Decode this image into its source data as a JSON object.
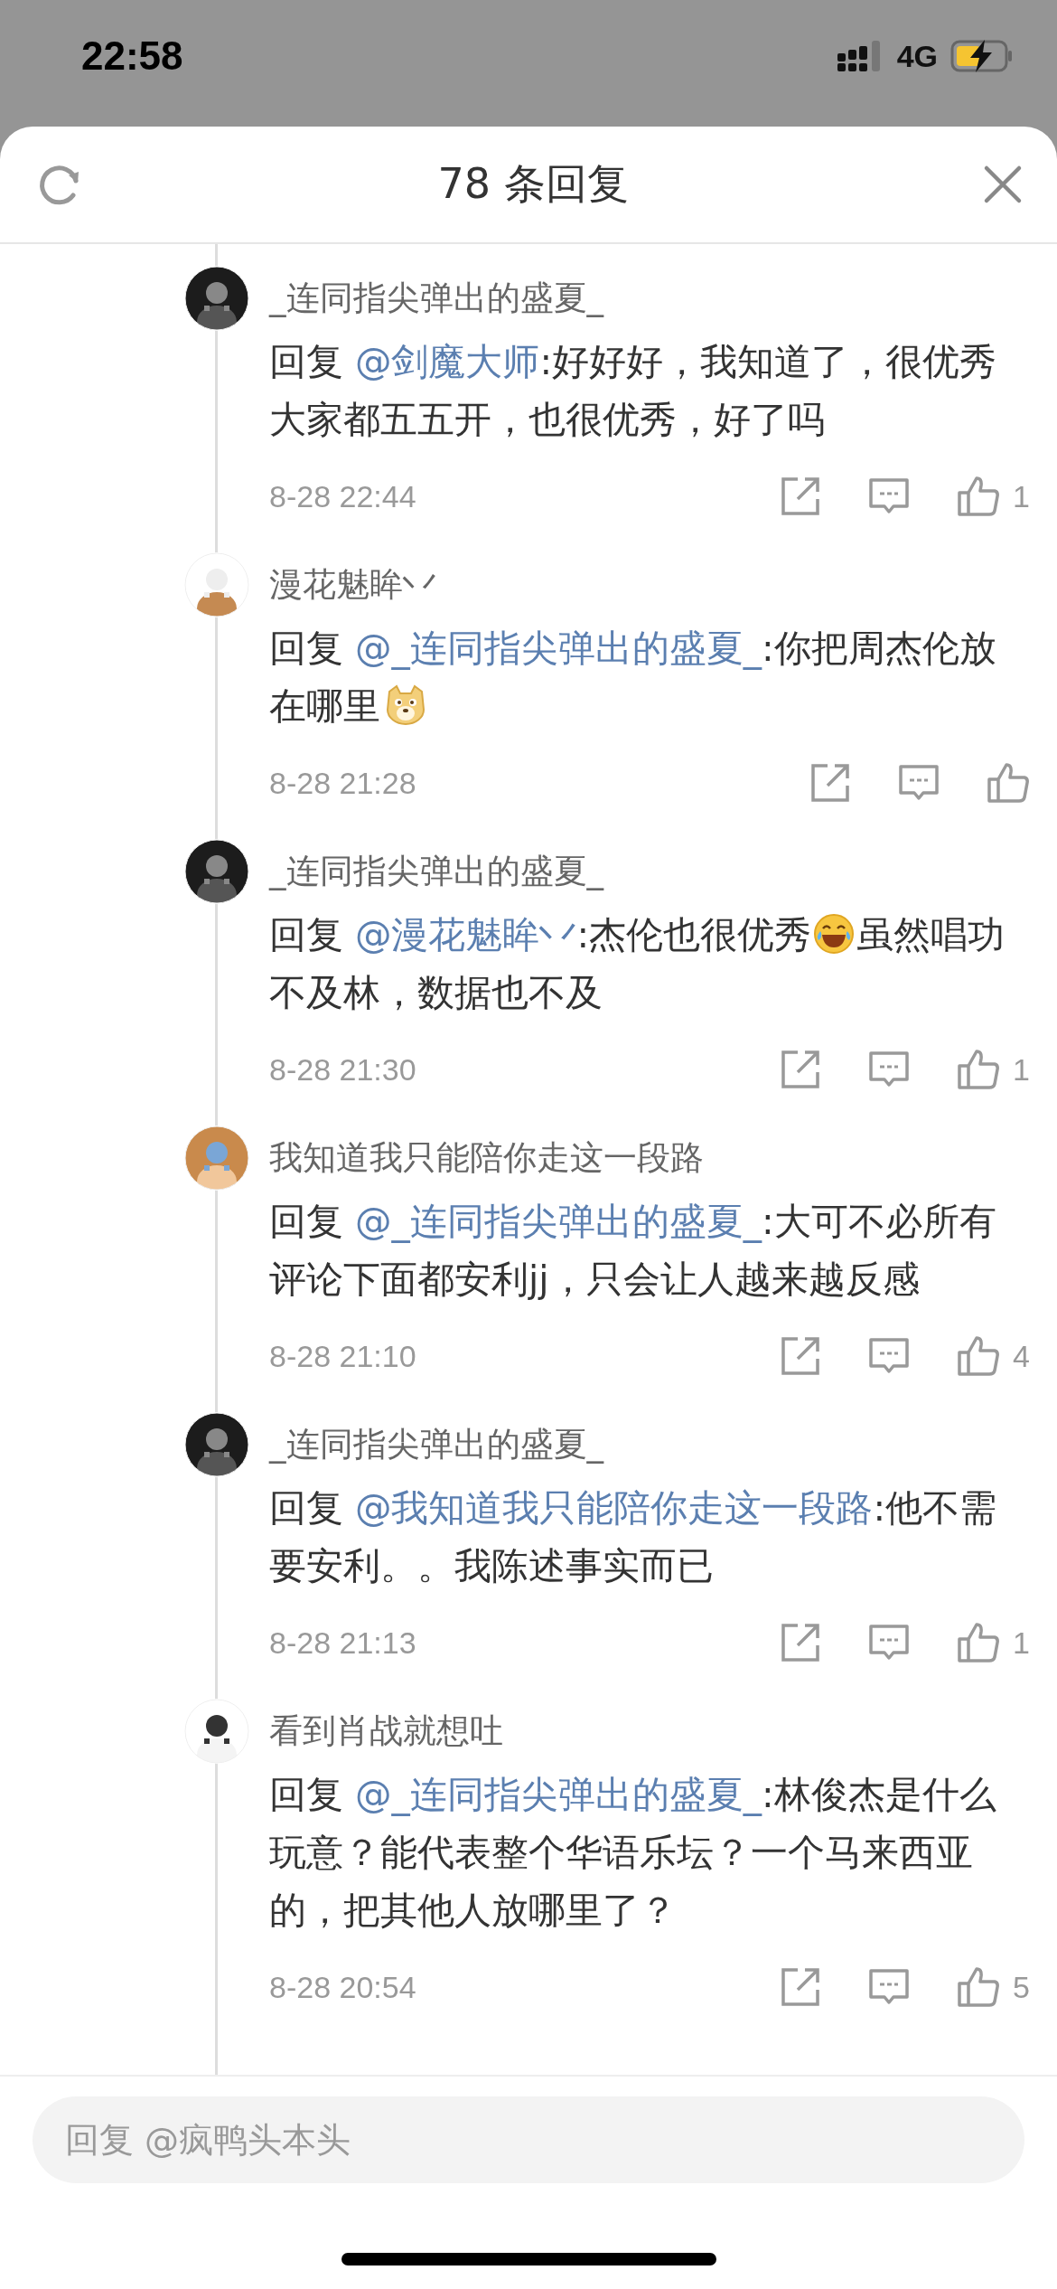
{
  "status_bar": {
    "time": "22:58",
    "network": "4G"
  },
  "header": {
    "title": "78 条回复"
  },
  "comments": [
    {
      "author": "_连同指尖弹出的盛夏_",
      "body": [
        {
          "kind": "text",
          "text": "回复 "
        },
        {
          "kind": "mention",
          "text": "@剑魔大师"
        },
        {
          "kind": "text",
          "text": ":好好好，我知道了，很优秀大家都五五开，也很优秀，好了吗"
        }
      ],
      "time": "8-28 22:44",
      "likes": "1"
    },
    {
      "author": "漫花魅眸丷",
      "body": [
        {
          "kind": "text",
          "text": "回复 "
        },
        {
          "kind": "mention",
          "text": "@_连同指尖弹出的盛夏_"
        },
        {
          "kind": "text",
          "text": ":你把周杰伦放在哪里"
        },
        {
          "kind": "dog-emoji"
        }
      ],
      "time": "8-28 21:28"
    },
    {
      "author": "_连同指尖弹出的盛夏_",
      "body": [
        {
          "kind": "text",
          "text": "回复 "
        },
        {
          "kind": "mention",
          "text": "@漫花魅眸丷"
        },
        {
          "kind": "text",
          "text": ":杰伦也很优秀"
        },
        {
          "kind": "laugh-emoji"
        },
        {
          "kind": "text",
          "text": "虽然唱功不及林，数据也不及"
        }
      ],
      "time": "8-28 21:30",
      "likes": "1"
    },
    {
      "author": "我知道我只能陪你走这一段路",
      "body": [
        {
          "kind": "text",
          "text": "回复 "
        },
        {
          "kind": "mention",
          "text": "@_连同指尖弹出的盛夏_"
        },
        {
          "kind": "text",
          "text": ":大可不必所有评论下面都安利jj，只会让人越来越反感"
        }
      ],
      "time": "8-28 21:10",
      "likes": "4"
    },
    {
      "author": "_连同指尖弹出的盛夏_",
      "body": [
        {
          "kind": "text",
          "text": "回复 "
        },
        {
          "kind": "mention",
          "text": "@我知道我只能陪你走这一段路"
        },
        {
          "kind": "text",
          "text": ":他不需要安利。。我陈述事实而已"
        }
      ],
      "time": "8-28 21:13",
      "likes": "1"
    },
    {
      "author": "看到肖战就想吐",
      "body": [
        {
          "kind": "text",
          "text": "回复 "
        },
        {
          "kind": "mention",
          "text": "@_连同指尖弹出的盛夏_"
        },
        {
          "kind": "text",
          "text": ":林俊杰是什么玩意？能代表整个华语乐坛？一个马来西亚的，把其他人放哪里了？"
        }
      ],
      "time": "8-28 20:54",
      "likes": "5"
    }
  ],
  "reply_box": {
    "placeholder": "回复 @疯鸭头本头"
  }
}
